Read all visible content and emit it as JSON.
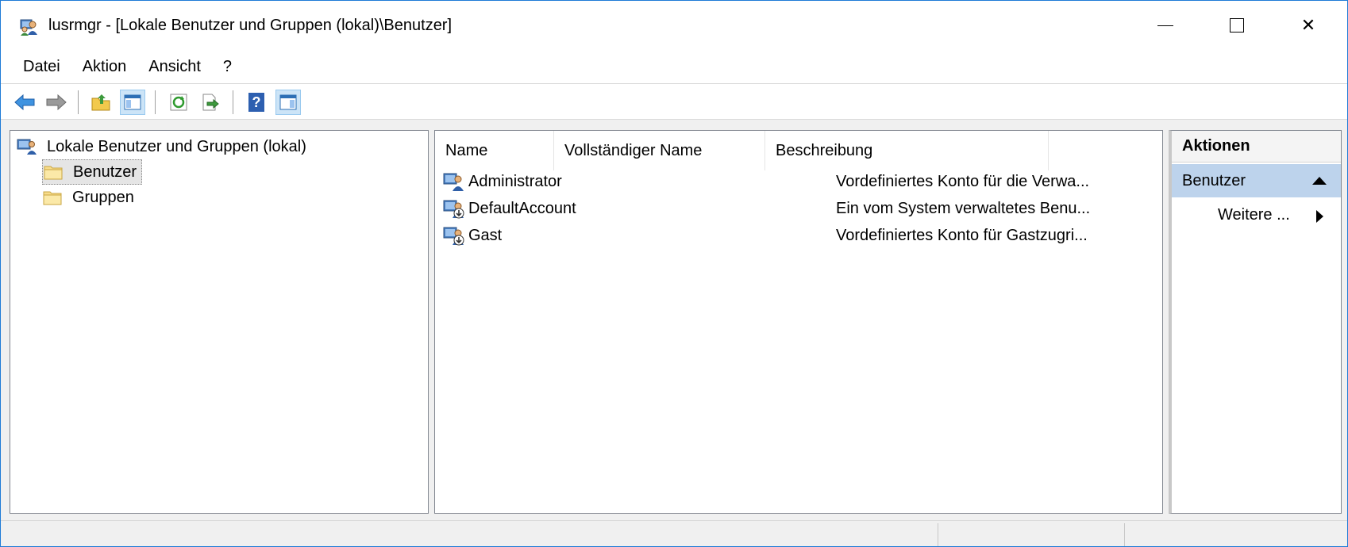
{
  "window": {
    "title": "lusrmgr - [Lokale Benutzer und Gruppen (lokal)\\Benutzer]",
    "app_icon": "users-icon",
    "controls": {
      "minimize": "minimize-icon",
      "maximize": "maximize-icon",
      "close": "close-icon"
    },
    "close_glyph": "✕"
  },
  "menu": {
    "items": [
      "Datei",
      "Aktion",
      "Ansicht",
      "?"
    ]
  },
  "toolbar": {
    "buttons": [
      "back-icon",
      "forward-icon",
      "up-folder-icon",
      "show-hide-tree-icon",
      "refresh-icon",
      "export-list-icon",
      "help-icon",
      "show-hide-action-pane-icon"
    ],
    "help_glyph": "?"
  },
  "tree": {
    "root": "Lokale Benutzer und Gruppen (lokal)",
    "items": [
      {
        "label": "Benutzer",
        "selected": true
      },
      {
        "label": "Gruppen",
        "selected": false
      }
    ]
  },
  "list": {
    "columns": [
      "Name",
      "Vollständiger Name",
      "Beschreibung"
    ],
    "rows": [
      {
        "name": "Administrator",
        "full_name": "",
        "description": "Vordefiniertes Konto für die Verwa..."
      },
      {
        "name": "DefaultAccount",
        "full_name": "",
        "description": "Ein vom System verwaltetes Benu..."
      },
      {
        "name": "Gast",
        "full_name": "",
        "description": "Vordefiniertes Konto für Gastzugri..."
      }
    ]
  },
  "actions": {
    "header": "Aktionen",
    "section": "Benutzer",
    "item": "Weitere ..."
  },
  "colors": {
    "window_border": "#1e7bd7",
    "selection": "#bdd3ec",
    "toolbar_active": "#cce4f7"
  }
}
